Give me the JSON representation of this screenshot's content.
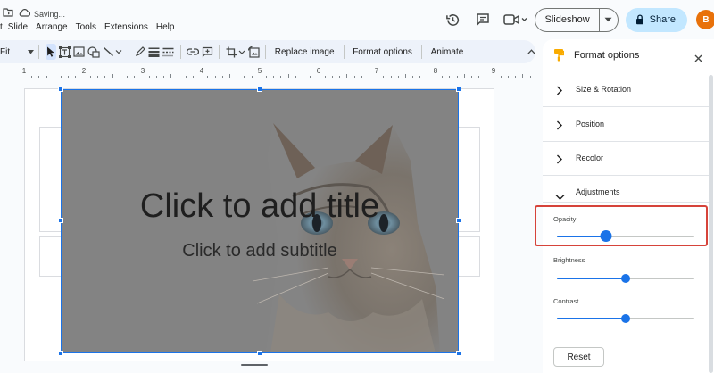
{
  "header": {
    "saving_text": "Saving...",
    "menu": [
      "t",
      "Slide",
      "Arrange",
      "Tools",
      "Extensions",
      "Help"
    ],
    "slideshow_label": "Slideshow",
    "share_label": "Share",
    "avatar_initial": "B"
  },
  "toolbar": {
    "fit_label": "Fit",
    "replace_image": "Replace image",
    "format_options": "Format options",
    "animate": "Animate"
  },
  "ruler": {
    "numbers": [
      "1",
      "2",
      "3",
      "4",
      "5",
      "6",
      "7",
      "8",
      "9"
    ]
  },
  "slide": {
    "title_placeholder": "Click to add title",
    "subtitle_placeholder": "Click to add subtitle"
  },
  "panel": {
    "title": "Format options",
    "sections": [
      {
        "label": "Size & Rotation",
        "expanded": false
      },
      {
        "label": "Position",
        "expanded": false
      },
      {
        "label": "Recolor",
        "expanded": false
      },
      {
        "label": "Adjustments",
        "expanded": true
      }
    ],
    "adjustments": {
      "opacity": {
        "label": "Opacity",
        "value": 0.36
      },
      "brightness": {
        "label": "Brightness",
        "value": 0.5
      },
      "contrast": {
        "label": "Contrast",
        "value": 0.5
      }
    },
    "reset_label": "Reset"
  },
  "colors": {
    "accent": "#1a73e8",
    "share_bg": "#c2e7ff",
    "highlight": "#d6433a",
    "avatar_bg": "#e8710a"
  }
}
